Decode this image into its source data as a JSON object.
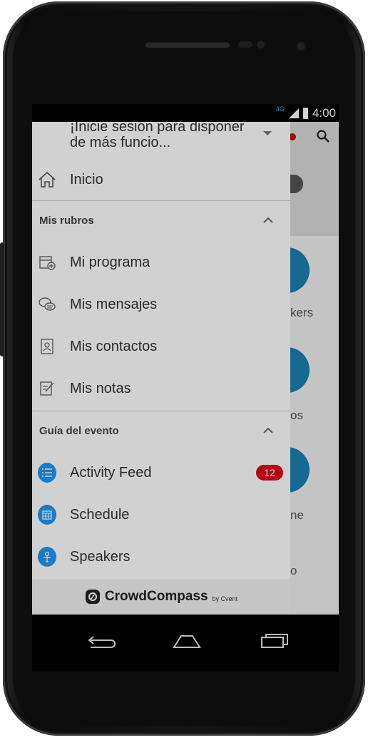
{
  "status_bar": {
    "network": "4G",
    "time": "4:00"
  },
  "drawer": {
    "login_prompt": "¡Inicie sesión para disponer de más funcio...",
    "home": {
      "label": "Inicio",
      "icon": "home-icon"
    },
    "sections": [
      {
        "title": "Mis rubros",
        "expanded": true,
        "items": [
          {
            "label": "Mi programa",
            "icon": "calendar-add-icon"
          },
          {
            "label": "Mis mensajes",
            "icon": "chat-icon"
          },
          {
            "label": "Mis contactos",
            "icon": "contact-card-icon"
          },
          {
            "label": "Mis notas",
            "icon": "note-edit-icon"
          }
        ]
      },
      {
        "title": "Guía del evento",
        "expanded": true,
        "items": [
          {
            "label": "Activity Feed",
            "icon": "list-icon",
            "badge": "12"
          },
          {
            "label": "Schedule",
            "icon": "calendar-grid-icon"
          },
          {
            "label": "Speakers",
            "icon": "speaker-person-icon"
          }
        ]
      }
    ],
    "footer": {
      "brand": "CrowdCompass",
      "by": "by Cvent"
    }
  },
  "background_app": {
    "labels": [
      "kers",
      "os",
      "ne",
      "o"
    ]
  },
  "colors": {
    "accent_blue": "#2196f3",
    "badge_red": "#e0001b",
    "tile_blue": "#1a7fb0"
  }
}
